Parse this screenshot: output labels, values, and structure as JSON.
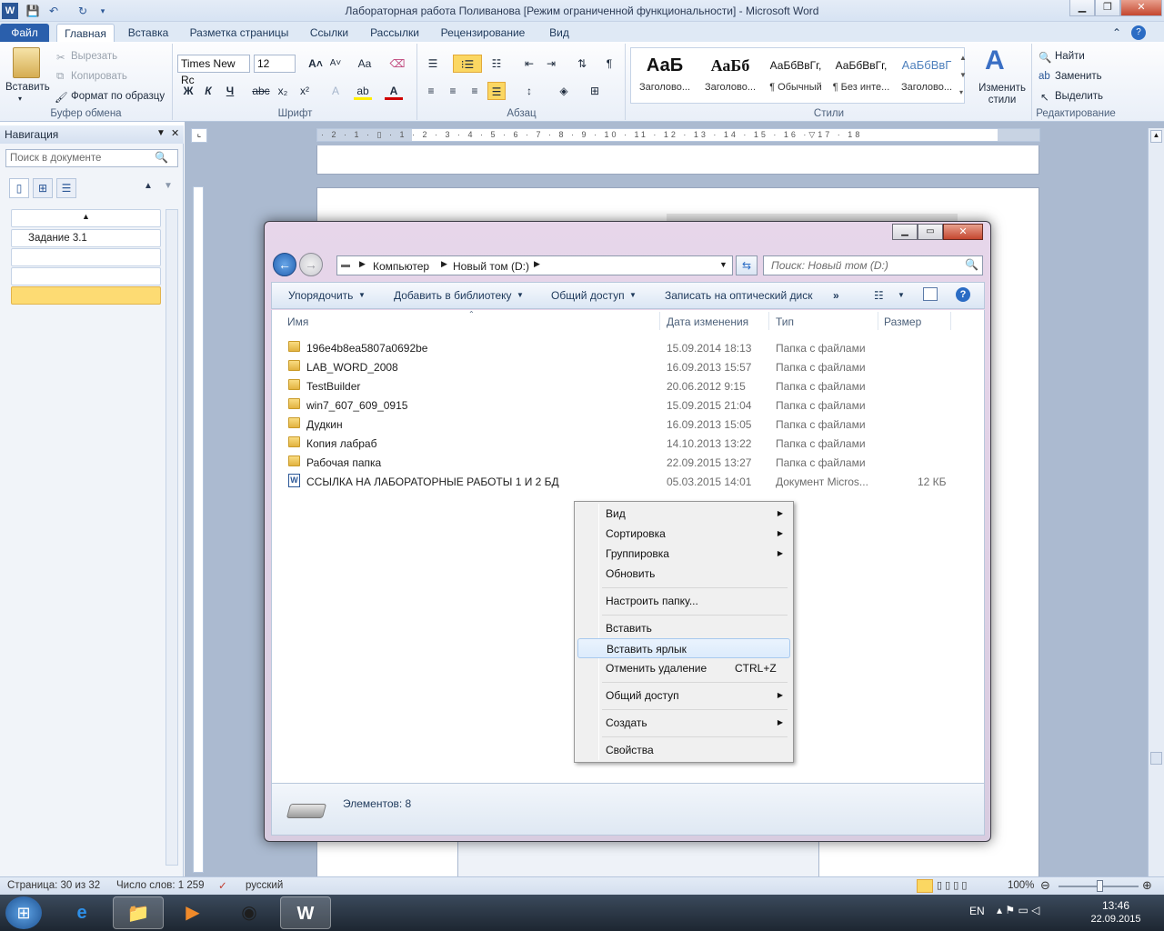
{
  "word": {
    "title": "Лабораторная работа Поливанова [Режим ограниченной функциональности]  -  Microsoft Word",
    "tabs": [
      "Файл",
      "Главная",
      "Вставка",
      "Разметка страницы",
      "Ссылки",
      "Рассылки",
      "Рецензирование",
      "Вид"
    ],
    "clipboard": {
      "paste": "Вставить",
      "cut": "Вырезать",
      "copy": "Копировать",
      "format_painter": "Формат по образцу",
      "label": "Буфер обмена"
    },
    "font": {
      "name": "Times New Rc",
      "size": "12",
      "label": "Шрифт"
    },
    "paragraph_label": "Абзац",
    "styles": {
      "items": [
        {
          "preview": "АаБ",
          "name": "Заголово..."
        },
        {
          "preview": "АаБб",
          "name": "Заголово..."
        },
        {
          "preview": "АаБбВвГг,",
          "name": "¶ Обычный"
        },
        {
          "preview": "АаБбВвГг,",
          "name": "¶ Без инте..."
        },
        {
          "preview": "АаБбВвГ",
          "name": "Заголово..."
        }
      ],
      "change_styles": "Изменить стили",
      "label": "Стили"
    },
    "editing": {
      "find": "Найти",
      "replace": "Заменить",
      "select": "Выделить",
      "label": "Редактирование"
    },
    "nav": {
      "title": "Навигация",
      "search_placeholder": "Поиск в документе",
      "items": [
        "Задание 3.1"
      ]
    },
    "ruler_marks": "· 2 · 1 · ▯ · 1 · 2 · 3 · 4 · 5 · 6 · 7 · 8 · 9 · 10 · 11 · 12 · 13 · 14 · 15 · 16 ·▽17 · 18",
    "status": {
      "page": "Страница: 30 из 32",
      "words": "Число слов: 1 259",
      "lang": "русский",
      "zoom": "100%"
    }
  },
  "explorer": {
    "address": [
      "Компьютер",
      "Новый том (D:)"
    ],
    "search_placeholder": "Поиск: Новый том (D:)",
    "commands": [
      "Упорядочить",
      "Добавить в библиотеку",
      "Общий доступ",
      "Записать на оптический диск"
    ],
    "more": "»",
    "columns": {
      "name": "Имя",
      "date": "Дата изменения",
      "type": "Тип",
      "size": "Размер"
    },
    "files": [
      {
        "name": "196e4b8ea5807a0692be",
        "date": "15.09.2014 18:13",
        "type": "Папка с файлами",
        "size": ""
      },
      {
        "name": "LAB_WORD_2008",
        "date": "16.09.2013 15:57",
        "type": "Папка с файлами",
        "size": ""
      },
      {
        "name": "TestBuilder",
        "date": "20.06.2012 9:15",
        "type": "Папка с файлами",
        "size": ""
      },
      {
        "name": "win7_607_609_0915",
        "date": "15.09.2015 21:04",
        "type": "Папка с файлами",
        "size": ""
      },
      {
        "name": "Дудкин",
        "date": "16.09.2013 15:05",
        "type": "Папка с файлами",
        "size": ""
      },
      {
        "name": "Копия лабраб",
        "date": "14.10.2013 13:22",
        "type": "Папка с файлами",
        "size": ""
      },
      {
        "name": "Рабочая папка",
        "date": "22.09.2015 13:27",
        "type": "Папка с файлами",
        "size": ""
      },
      {
        "name": "ССЫЛКА НА ЛАБОРАТОРНЫЕ РАБОТЫ 1 И 2 БД",
        "date": "05.03.2015 14:01",
        "type": "Документ Micros...",
        "size": "12 КБ"
      }
    ],
    "item_count": "Элементов: 8"
  },
  "context_menu": [
    {
      "label": "Вид",
      "submenu": true
    },
    {
      "label": "Сортировка",
      "submenu": true
    },
    {
      "label": "Группировка",
      "submenu": true
    },
    {
      "label": "Обновить"
    },
    {
      "separator": true
    },
    {
      "label": "Настроить папку..."
    },
    {
      "separator": true
    },
    {
      "label": "Вставить"
    },
    {
      "label": "Вставить ярлык",
      "highlighted": true
    },
    {
      "label": "Отменить удаление",
      "shortcut": "CTRL+Z"
    },
    {
      "separator": true
    },
    {
      "label": "Общий доступ",
      "submenu": true
    },
    {
      "separator": true
    },
    {
      "label": "Создать",
      "submenu": true
    },
    {
      "separator": true
    },
    {
      "label": "Свойства"
    }
  ],
  "taskbar": {
    "lang": "EN",
    "time": "13:46",
    "date": "22.09.2015"
  }
}
